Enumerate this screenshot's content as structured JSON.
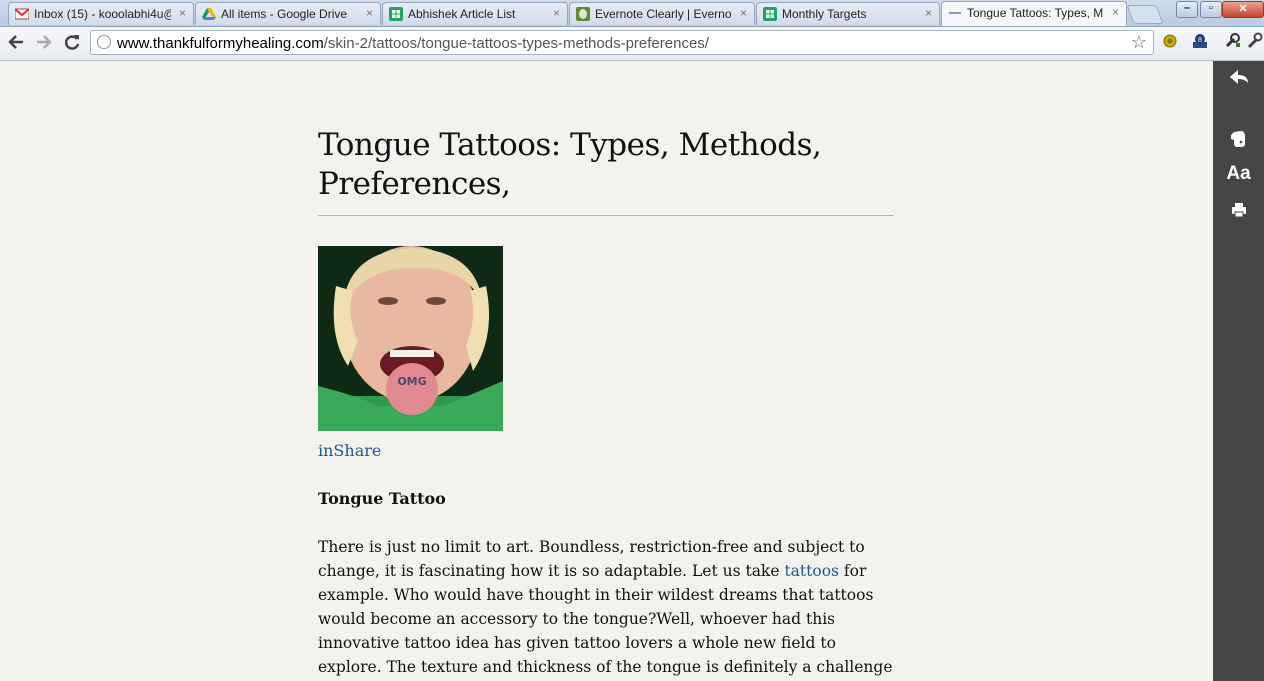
{
  "browser": {
    "tabs": [
      {
        "title": "Inbox (15) - kooolabhi4u@",
        "close": "×"
      },
      {
        "title": "All items - Google Drive",
        "close": "×"
      },
      {
        "title": "Abhishek Article List",
        "close": "×"
      },
      {
        "title": "Evernote Clearly | Evernote",
        "close": "×"
      },
      {
        "title": "Monthly Targets",
        "close": "×"
      },
      {
        "title": "Tongue Tattoos: Types, M",
        "close": "×"
      }
    ],
    "url_host": "www.thankfulformyhealing.com",
    "url_path": "/skin-2/tattoos/tongue-tattoos-types-methods-preferences/"
  },
  "article": {
    "title": "Tongue Tattoos: Types, Methods, Preferences,",
    "photo_tattoo_text": "OMG",
    "inshare_link": "inShare",
    "subheading": "Tongue Tattoo",
    "para_before_link": "There is just no limit to art. Boundless, restriction-free and subject to change, it is fascinating how it is so adaptable. Let us take ",
    "para_link": "tattoos",
    "para_after_link": " for example. Who would have thought in their wildest dreams that tattoos would become an accessory to the tongue?Well, whoever had this innovative tattoo idea has given tattoo lovers a whole new field to explore. The texture and thickness of the tongue is definitely a challenge and the area greatly limits the design but it lets people"
  },
  "sidebar": {
    "font_size_label": "Aa"
  }
}
